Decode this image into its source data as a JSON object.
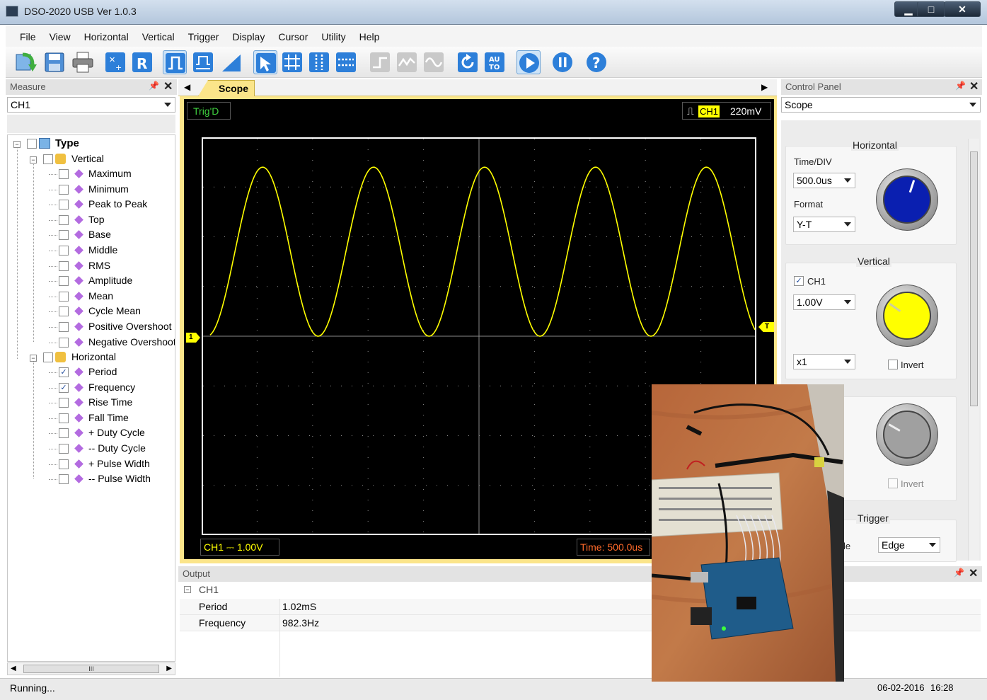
{
  "window": {
    "title": "DSO-2020 USB Ver 1.0.3"
  },
  "menu": [
    "File",
    "View",
    "Horizontal",
    "Vertical",
    "Trigger",
    "Display",
    "Cursor",
    "Utility",
    "Help"
  ],
  "measure": {
    "title": "Measure",
    "channel": "CH1",
    "tree": {
      "root": "Type",
      "vertical_label": "Vertical",
      "vertical_items": [
        {
          "label": "Maximum",
          "checked": false
        },
        {
          "label": "Minimum",
          "checked": false
        },
        {
          "label": "Peak to Peak",
          "checked": false
        },
        {
          "label": "Top",
          "checked": false
        },
        {
          "label": "Base",
          "checked": false
        },
        {
          "label": "Middle",
          "checked": false
        },
        {
          "label": "RMS",
          "checked": false
        },
        {
          "label": "Amplitude",
          "checked": false
        },
        {
          "label": "Mean",
          "checked": false
        },
        {
          "label": "Cycle Mean",
          "checked": false
        },
        {
          "label": "Positive Overshoot",
          "checked": false
        },
        {
          "label": "Negative Overshoot",
          "checked": false
        }
      ],
      "horizontal_label": "Horizontal",
      "horizontal_items": [
        {
          "label": "Period",
          "checked": true
        },
        {
          "label": "Frequency",
          "checked": true
        },
        {
          "label": "Rise Time",
          "checked": false
        },
        {
          "label": "Fall Time",
          "checked": false
        },
        {
          "label": "+ Duty Cycle",
          "checked": false
        },
        {
          "label": "-- Duty Cycle",
          "checked": false
        },
        {
          "label": "+ Pulse Width",
          "checked": false
        },
        {
          "label": "-- Pulse Width",
          "checked": false
        }
      ]
    },
    "scroll_thumb": "III"
  },
  "scope": {
    "tab_label": "Scope",
    "trig_status": "Trig'D",
    "trig_channel": "CH1",
    "trig_level": "220mV",
    "ch1_marker": "1",
    "trig_marker": "T",
    "ch1_scale": "CH1 ⎓  1.00V",
    "time_scale": "Time: 500.0us",
    "trace_color": "#ffff00",
    "waveform": {
      "type": "sine",
      "cycles_visible": 4.9,
      "peaks_x_div": [
        1.1,
        3.1,
        5.0,
        7.1,
        9.1
      ]
    }
  },
  "control_panel": {
    "title": "Control Panel",
    "mode": "Scope",
    "horizontal": {
      "title": "Horizontal",
      "time_div_label": "Time/DIV",
      "time_div": "500.0us",
      "format_label": "Format",
      "format": "Y-T",
      "knob_color": "#0a1fb0"
    },
    "vertical": {
      "title": "Vertical",
      "ch1_label": "CH1",
      "ch1_checked": true,
      "volt_div": "1.00V",
      "probe": "x1",
      "invert_label": "Invert",
      "invert_checked": false,
      "knob_color": "#ffff00"
    },
    "ch2": {
      "invert_label": "Invert",
      "knob_color": "#a0a0a0"
    },
    "trigger": {
      "title": "Trigger",
      "mode_label_partial": "le",
      "mode": "Edge"
    }
  },
  "output": {
    "title": "Output",
    "group": "CH1",
    "rows": [
      {
        "key": "Period",
        "value": "1.02mS"
      },
      {
        "key": "Frequency",
        "value": "982.3Hz"
      }
    ]
  },
  "status": {
    "text": "Running...",
    "date": "06-02-2016",
    "time": "16:28"
  },
  "icons": {
    "toolbar": [
      "open-icon",
      "save-icon",
      "print-icon",
      "auto-measure-icon",
      "reset-icon",
      "single-pulse-icon",
      "pulse-icon",
      "ramp-icon",
      "select-icon",
      "grid-icon",
      "vertical-cursor-icon",
      "horizontal-cursor-icon",
      "step-icon",
      "wave-icon",
      "sine-icon",
      "refresh-icon",
      "auto-icon",
      "run-icon",
      "pause-icon",
      "help-icon"
    ]
  }
}
